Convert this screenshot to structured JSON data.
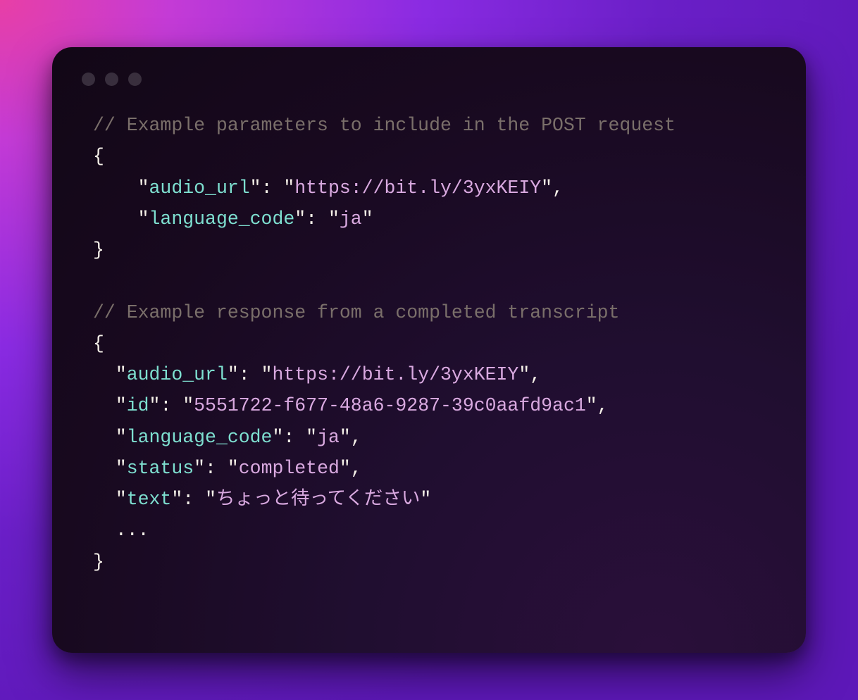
{
  "code": {
    "comment1": "// Example parameters to include in the POST request",
    "open_brace": "{",
    "close_brace": "}",
    "colon": ":",
    "comma": ",",
    "quote": "\"",
    "ellipsis": "...",
    "request": {
      "k_audio_url": "audio_url",
      "v_audio_url": "https://bit.ly/3yxKEIY",
      "k_language_code": "language_code",
      "v_language_code": "ja"
    },
    "comment2": "// Example response from a completed transcript",
    "response": {
      "k_audio_url": "audio_url",
      "v_audio_url": "https://bit.ly/3yxKEIY",
      "k_id": "id",
      "v_id": "5551722-f677-48a6-9287-39c0aafd9ac1",
      "k_language_code": "language_code",
      "v_language_code": "ja",
      "k_status": "status",
      "v_status": "completed",
      "k_text": "text",
      "v_text": "ちょっと待ってください"
    }
  }
}
